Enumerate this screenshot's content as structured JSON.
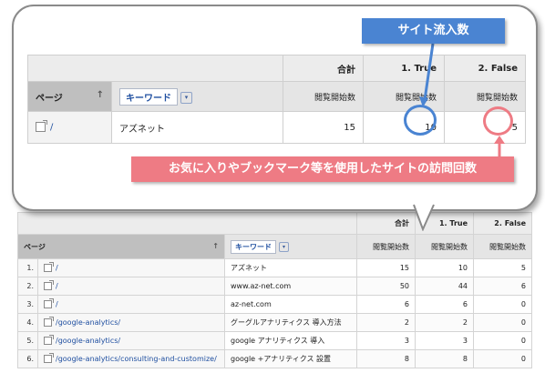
{
  "callout": {
    "blue_label": "サイト流入数",
    "pink_label": "お気に入りやブックマーク等を使用したサイトの訪問回数",
    "table": {
      "col_total": "合計",
      "col_true": "1. True",
      "col_false": "2. False",
      "page_header": "ページ",
      "keyword_button": "キーワード",
      "metric_label": "閲覧開始数",
      "row": {
        "page": "/",
        "keyword": "アズネット",
        "total": "15",
        "true_val": "10",
        "false_val": "5"
      }
    },
    "colors": {
      "blue": "#4a84d2",
      "pink": "#ee7b84"
    }
  },
  "report": {
    "col_total": "合計",
    "col_true": "1. True",
    "col_false": "2. False",
    "page_header": "ページ",
    "keyword_button": "キーワード",
    "metric_label": "閲覧開始数",
    "rows": [
      {
        "idx": "1.",
        "page": "/",
        "keyword": "アズネット",
        "total": "15",
        "true_val": "10",
        "false_val": "5"
      },
      {
        "idx": "2.",
        "page": "/",
        "keyword": "www.az-net.com",
        "total": "50",
        "true_val": "44",
        "false_val": "6"
      },
      {
        "idx": "3.",
        "page": "/",
        "keyword": "az-net.com",
        "total": "6",
        "true_val": "6",
        "false_val": "0"
      },
      {
        "idx": "4.",
        "page": "/google-analytics/",
        "keyword": "グーグルアナリティクス 導入方法",
        "total": "2",
        "true_val": "2",
        "false_val": "0"
      },
      {
        "idx": "5.",
        "page": "/google-analytics/",
        "keyword": "google アナリティクス 導入",
        "total": "3",
        "true_val": "3",
        "false_val": "0"
      },
      {
        "idx": "6.",
        "page": "/google-analytics/consulting-and-customize/",
        "keyword": "google +アナリティクス 設置",
        "total": "8",
        "true_val": "8",
        "false_val": "0"
      }
    ]
  }
}
